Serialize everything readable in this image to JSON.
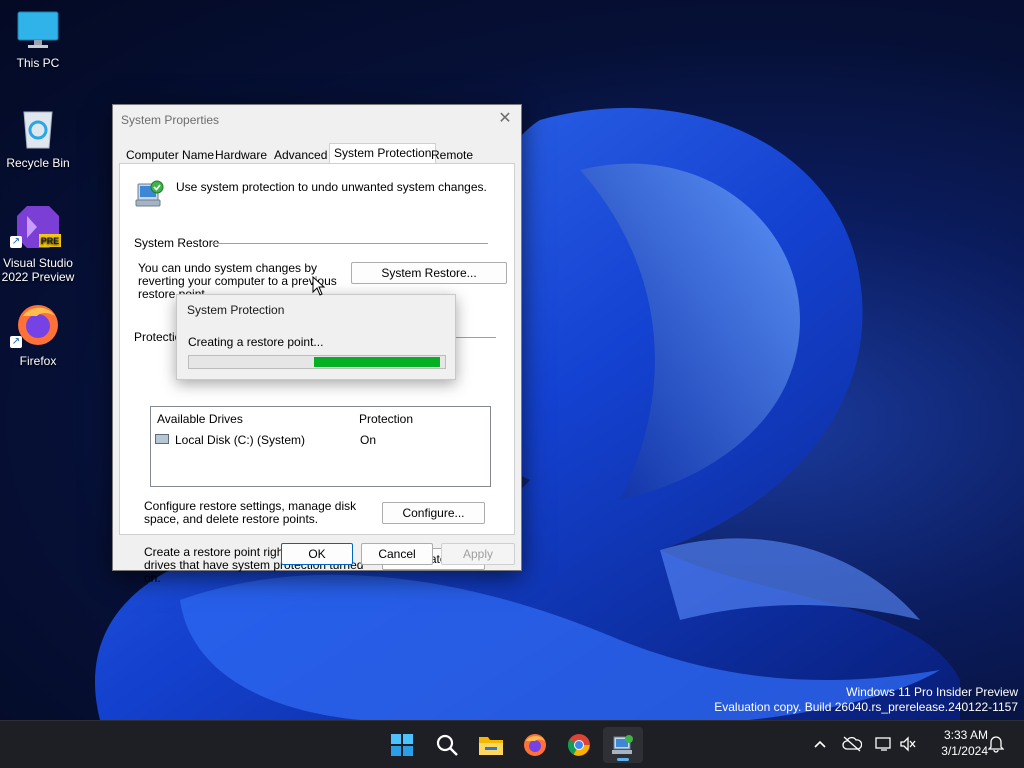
{
  "desktop": {
    "icons": [
      {
        "label": "This PC"
      },
      {
        "label": "Recycle Bin"
      },
      {
        "label": "Visual Studio 2022 Preview",
        "badge": "PRE"
      },
      {
        "label": "Firefox"
      }
    ]
  },
  "window": {
    "title": "System Properties",
    "close_glyph": "✕",
    "tabs": [
      "Computer Name",
      "Hardware",
      "Advanced",
      "System Protection",
      "Remote"
    ],
    "selected_tab": "System Protection",
    "intro": "Use system protection to undo unwanted system changes.",
    "restore_section": {
      "heading": "System Restore",
      "description": "You can undo system changes by reverting your computer to a previous restore point.",
      "button": "System Restore..."
    },
    "protection_section": {
      "heading": "Protection Settings",
      "column_available": "Available Drives",
      "column_protection": "Protection",
      "drives": [
        {
          "name": "Local Disk (C:) (System)",
          "protection": "On"
        }
      ]
    },
    "configure": {
      "description": "Configure restore settings, manage disk space, and delete restore points.",
      "button": "Configure..."
    },
    "create": {
      "description": "Create a restore point right now for the drives that have system protection turned on.",
      "button": "Create..."
    },
    "footer": {
      "ok": "OK",
      "cancel": "Cancel",
      "apply": "Apply"
    }
  },
  "progress_dialog": {
    "title": "System Protection",
    "message": "Creating a restore point...",
    "progress_start": 0.49,
    "progress_end": 0.98
  },
  "watermark": {
    "line1": "Windows 11 Pro Insider Preview",
    "line2": "Evaluation copy. Build 26040.rs_prerelease.240122-1157"
  },
  "taskbar": {
    "apps": [
      "start-icon",
      "search-icon",
      "file-explorer-icon",
      "firefox-icon",
      "chrome-icon",
      "system-properties-icon"
    ],
    "active_app": "system-properties-icon"
  },
  "tray": {
    "time": "3:33 AM",
    "date": "3/1/2024"
  },
  "colors": {
    "progress": "#06b025",
    "accent": "#0067c0"
  }
}
